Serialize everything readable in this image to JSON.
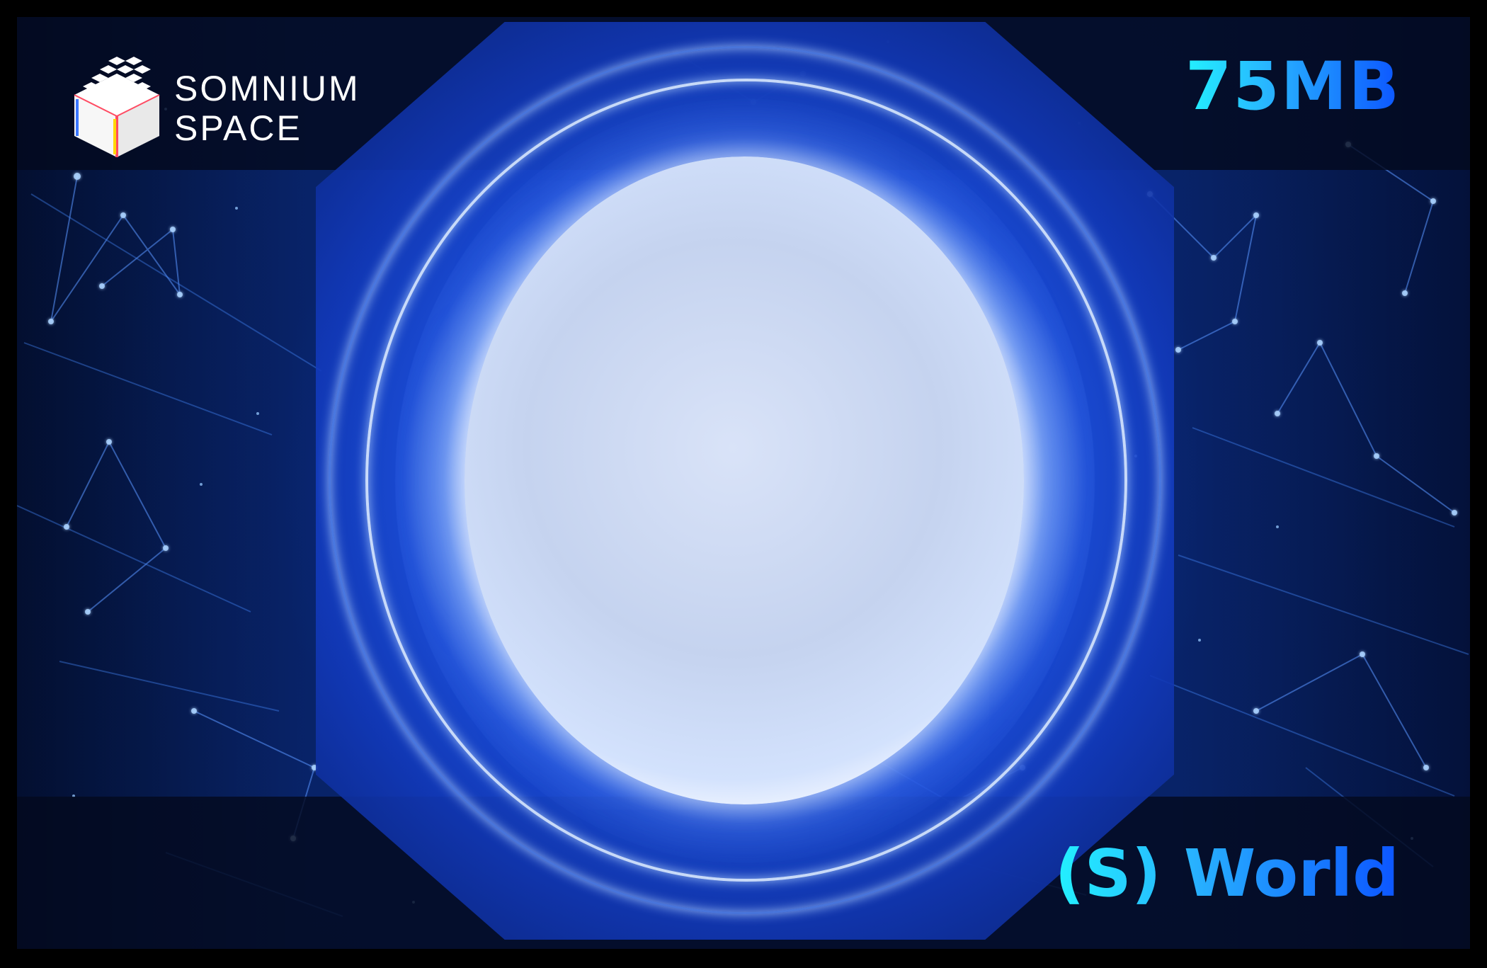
{
  "brand": {
    "line1": "SOMNIUM",
    "line2": "SPACE",
    "logo_icon": "voxel-cube-icon"
  },
  "badges": {
    "size": "75MB",
    "world": "(S) World"
  },
  "colors": {
    "background": "#000000",
    "panel_blue": "#0a2a78",
    "portal_blue": "#2d69ff",
    "portal_center": "#c5d3ef",
    "text_cyan": "#23f1ff",
    "text_blue": "#0c55ff",
    "band_dark": "#040a1e"
  }
}
